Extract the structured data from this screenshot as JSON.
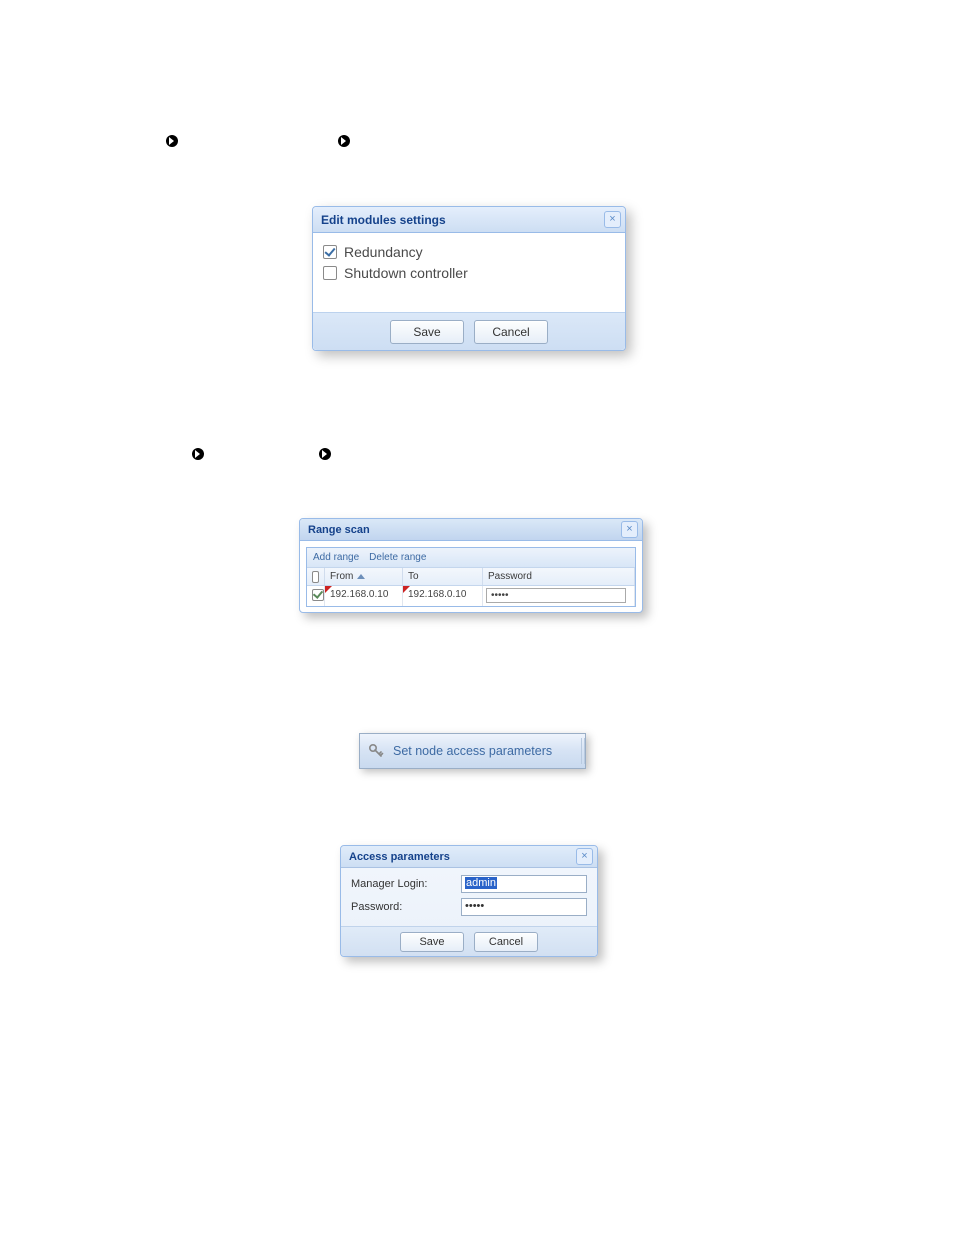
{
  "dialog1": {
    "title": "Edit modules settings",
    "opt_redundancy": "Redundancy",
    "opt_shutdown": "Shutdown controller",
    "redundancy_checked": true,
    "shutdown_checked": false,
    "save": "Save",
    "cancel": "Cancel"
  },
  "dialog2": {
    "title": "Range scan",
    "toolbar": {
      "add": "Add range",
      "del": "Delete range"
    },
    "headers": {
      "from": "From",
      "to": "To",
      "password": "Password"
    },
    "row": {
      "checked": true,
      "from": "192.168.0.10",
      "to": "192.168.0.10",
      "password": "•••••"
    }
  },
  "nodeButton": {
    "label": "Set node access parameters"
  },
  "dialog3": {
    "title": "Access parameters",
    "login_label": "Manager Login:",
    "login_value": "admin",
    "password_label": "Password:",
    "password_value": "•••••",
    "save": "Save",
    "cancel": "Cancel"
  }
}
